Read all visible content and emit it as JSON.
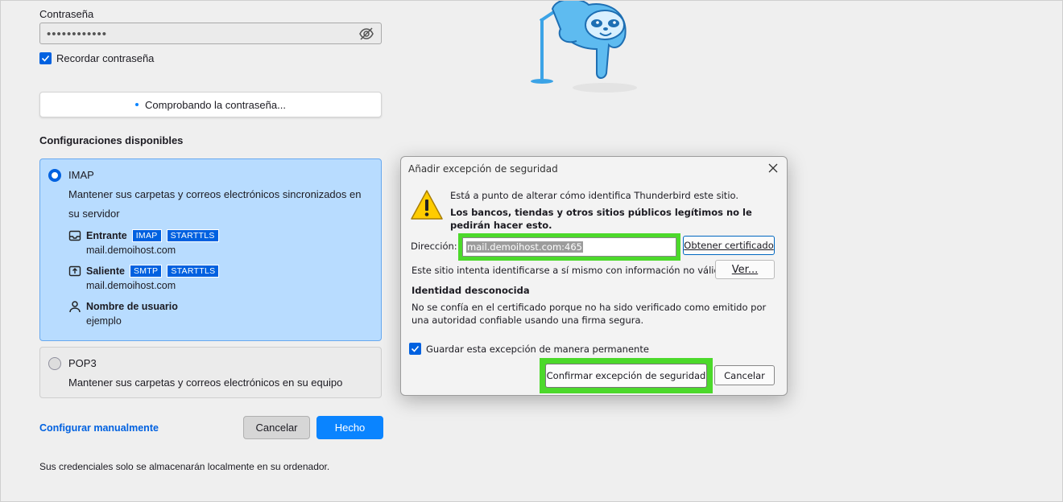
{
  "form": {
    "password_label": "Contraseña",
    "password_value": "••••••••••••",
    "remember_label": "Recordar contraseña",
    "checking_label": "Comprobando la contraseña...",
    "configs_title": "Configuraciones disponibles"
  },
  "imap": {
    "name": "IMAP",
    "description": "Mantener sus carpetas y correos electrónicos sincronizados en su servidor",
    "incoming_label": "Entrante",
    "incoming_tags": [
      "IMAP",
      "STARTTLS"
    ],
    "incoming_host": "mail.demoihost.com",
    "outgoing_label": "Saliente",
    "outgoing_tags": [
      "SMTP",
      "STARTTLS"
    ],
    "outgoing_host": "mail.demoihost.com",
    "username_label": "Nombre de usuario",
    "username_value": "ejemplo"
  },
  "pop3": {
    "name": "POP3",
    "description": "Mantener sus carpetas y correos electrónicos en su equipo"
  },
  "actions": {
    "manual_link": "Configurar manualmente",
    "cancel": "Cancelar",
    "done": "Hecho"
  },
  "footer_note": "Sus credenciales solo se almacenarán localmente en su ordenador.",
  "dialog": {
    "title": "Añadir excepción de seguridad",
    "line1": "Está a punto de alterar cómo identifica Thunderbird este sitio.",
    "line2": "Los bancos, tiendas y otros sitios públicos legítimos no le pedirán hacer esto.",
    "address_label": "Dirección:",
    "address_value": "mail.demoihost.com:465",
    "get_cert_button": "Obtener certificado",
    "invalid_text": "Este sitio intenta identificarse a sí mismo con información no válida.",
    "view_button": "Ver...",
    "unknown_title": "Identidad desconocida",
    "unknown_desc": "No se confía en el certificado porque no ha sido verificado como emitido por una autoridad confiable usando una firma segura.",
    "permanent_label": "Guardar esta excepción de manera permanente",
    "confirm_button": "Confirmar excepción de seguridad",
    "cancel_button": "Cancelar"
  },
  "colors": {
    "accent": "#0061e0",
    "highlight": "#4cd92b",
    "selected_card": "#b8dcff"
  }
}
